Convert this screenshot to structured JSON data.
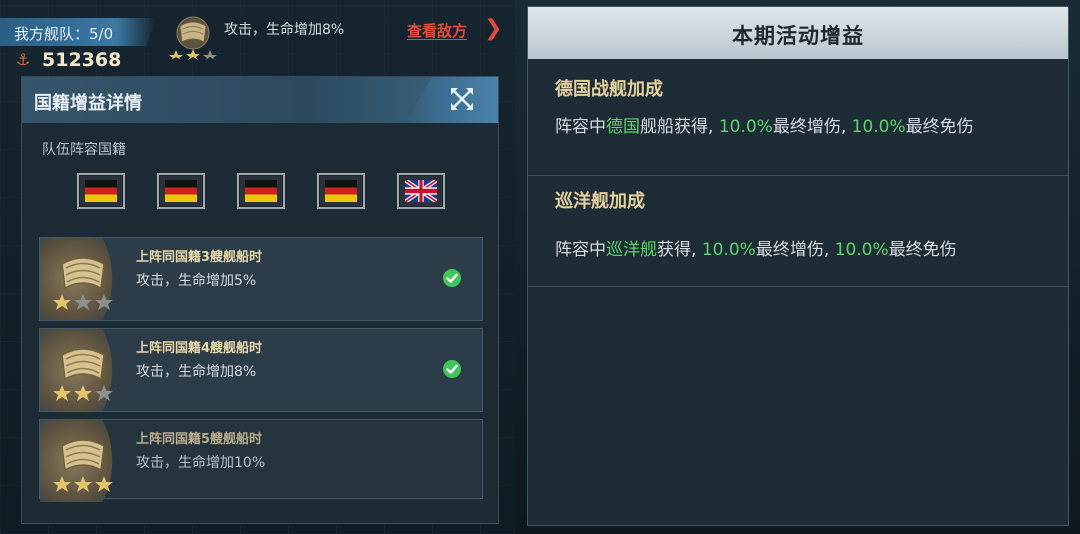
{
  "top_bar": {
    "fleet_label": "我方舰队：5/0",
    "power_value": "512368",
    "current_buff": "攻击，生命增加8%",
    "view_enemy_label": "查看敌方",
    "view_enemy_arrow": "❯"
  },
  "nationality_panel": {
    "title": "国籍增益详情",
    "lineup_label": "队伍阵容国籍",
    "flags": [
      "germany-flag",
      "germany-flag",
      "germany-flag",
      "germany-flag",
      "uk-flag"
    ],
    "tiers": [
      {
        "title": "上阵同国籍3艘舰船时",
        "desc": "攻击，生命增加5%",
        "stars": 3,
        "achieved": true
      },
      {
        "title": "上阵同国籍4艘舰船时",
        "desc": "攻击，生命增加8%",
        "stars": 3,
        "achieved": true
      },
      {
        "title": "上阵同国籍5艘舰船时",
        "desc": "攻击，生命增加10%",
        "stars": 3,
        "achieved": false
      }
    ]
  },
  "event_panel": {
    "title": "本期活动增益",
    "sections": [
      {
        "heading": "德国战舰加成",
        "line1_pre": "阵容中",
        "line1_hl": "德国",
        "line1_mid": "舰船获得, ",
        "line1_v1": "10.0%",
        "line1_mid2": "最终增伤, ",
        "line1_v2": "10.0%",
        "line1_post": "最终免伤"
      },
      {
        "heading": "巡洋舰加成",
        "line1_pre": "阵容中",
        "line1_hl": "巡洋舰",
        "line1_mid": "获得, ",
        "line1_v1": "10.0%",
        "line1_mid2": "最终增伤, ",
        "line1_v2": "10.0%",
        "line1_post": "最终免伤"
      }
    ]
  },
  "colors": {
    "accent_red": "#e24a3b",
    "highlight_green": "#5dd36b",
    "gold_text": "#e3d09c"
  }
}
